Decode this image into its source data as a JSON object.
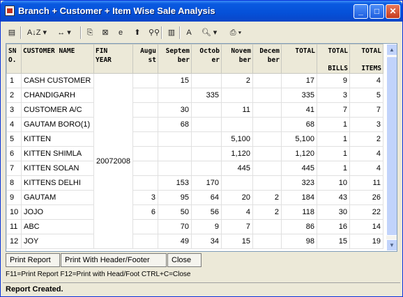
{
  "window": {
    "title": "Branch + Customer + Item Wise Sale Analysis"
  },
  "toolbar": {
    "items": [
      {
        "name": "save-icon",
        "glyph": "▤"
      },
      {
        "name": "sort-icon",
        "glyph": "A↓Z ▾"
      },
      {
        "name": "column-width-icon",
        "glyph": "↔ ▾"
      },
      {
        "name": "copy-icon",
        "glyph": "⎘"
      },
      {
        "name": "excel-icon",
        "glyph": "⊠"
      },
      {
        "name": "browser-icon",
        "glyph": "e"
      },
      {
        "name": "up-arrow-icon",
        "glyph": "⬆"
      },
      {
        "name": "find-icon",
        "glyph": "⚲⚲"
      },
      {
        "name": "chart-icon",
        "glyph": "▥"
      },
      {
        "name": "font-icon",
        "glyph": "A"
      },
      {
        "name": "print-preview-icon",
        "glyph": "🔍︎ ▾"
      },
      {
        "name": "printer-icon",
        "glyph": "⎙ ▾"
      }
    ]
  },
  "grid": {
    "headers": {
      "sno": [
        "SN",
        "O."
      ],
      "customer": [
        "CUSTOMER NAME"
      ],
      "fin_year": [
        "FIN",
        "YEAR"
      ],
      "august": [
        "Augu",
        "st"
      ],
      "september": [
        "Septem",
        "ber"
      ],
      "october": [
        "Octob",
        "er"
      ],
      "november": [
        "Novem",
        "ber"
      ],
      "december": [
        "Decem",
        "ber"
      ],
      "total": [
        "TOTAL"
      ],
      "total_bills": [
        "TOTAL",
        "",
        "BILLS"
      ],
      "total_items": [
        "TOTAL",
        "",
        "ITEMS"
      ]
    },
    "fin_year": "20072008",
    "rows": [
      {
        "sno": "1",
        "customer": "CASH CUSTOMER",
        "aug": "",
        "sep": "15",
        "oct": "",
        "nov": "2",
        "dec": "",
        "total": "17",
        "bills": "9",
        "items": "4"
      },
      {
        "sno": "2",
        "customer": "CHANDIGARH",
        "aug": "",
        "sep": "",
        "oct": "335",
        "nov": "",
        "dec": "",
        "total": "335",
        "bills": "3",
        "items": "5"
      },
      {
        "sno": "3",
        "customer": "CUSTOMER A/C",
        "aug": "",
        "sep": "30",
        "oct": "",
        "nov": "11",
        "dec": "",
        "total": "41",
        "bills": "7",
        "items": "7"
      },
      {
        "sno": "4",
        "customer": "GAUTAM   BORO(1)",
        "aug": "",
        "sep": "68",
        "oct": "",
        "nov": "",
        "dec": "",
        "total": "68",
        "bills": "1",
        "items": "3"
      },
      {
        "sno": "5",
        "customer": "KITTEN",
        "aug": "",
        "sep": "",
        "oct": "",
        "nov": "5,100",
        "dec": "",
        "total": "5,100",
        "bills": "1",
        "items": "2"
      },
      {
        "sno": "6",
        "customer": "KITTEN SHIMLA",
        "aug": "",
        "sep": "",
        "oct": "",
        "nov": "1,120",
        "dec": "",
        "total": "1,120",
        "bills": "1",
        "items": "4"
      },
      {
        "sno": "7",
        "customer": "KITTEN SOLAN",
        "aug": "",
        "sep": "",
        "oct": "",
        "nov": "445",
        "dec": "",
        "total": "445",
        "bills": "1",
        "items": "4"
      },
      {
        "sno": "8",
        "customer": "KITTENS DELHI",
        "aug": "",
        "sep": "153",
        "oct": "170",
        "nov": "",
        "dec": "",
        "total": "323",
        "bills": "10",
        "items": "11"
      },
      {
        "sno": "9",
        "customer": "GAUTAM",
        "aug": "3",
        "sep": "95",
        "oct": "64",
        "nov": "20",
        "dec": "2",
        "total": "184",
        "bills": "43",
        "items": "26"
      },
      {
        "sno": "10",
        "customer": "JOJO",
        "aug": "6",
        "sep": "50",
        "oct": "56",
        "nov": "4",
        "dec": "2",
        "total": "118",
        "bills": "30",
        "items": "22"
      },
      {
        "sno": "11",
        "customer": "ABC",
        "aug": "",
        "sep": "70",
        "oct": "9",
        "nov": "7",
        "dec": "",
        "total": "86",
        "bills": "16",
        "items": "14"
      },
      {
        "sno": "12",
        "customer": "JOY",
        "aug": "",
        "sep": "49",
        "oct": "34",
        "nov": "15",
        "dec": "",
        "total": "98",
        "bills": "15",
        "items": "19"
      }
    ]
  },
  "buttons": {
    "print_report": "Print Report",
    "print_header_footer": "Print With Header/Footer",
    "close": "Close"
  },
  "hint": "F11=Print Report  F12=Print with Head/Foot  CTRL+C=Close",
  "status": "Report Created."
}
